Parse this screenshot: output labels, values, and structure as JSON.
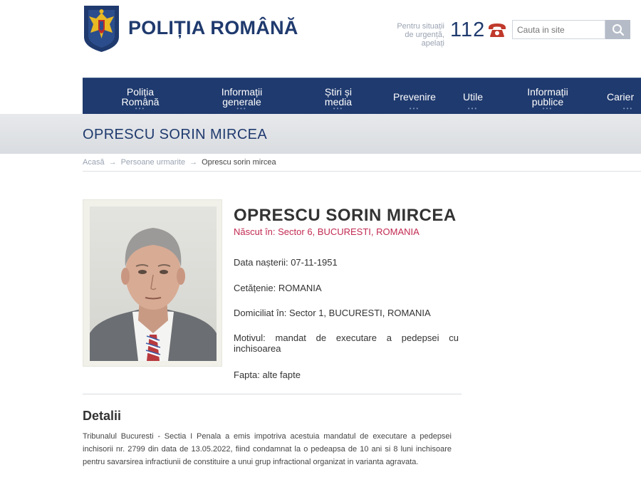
{
  "header": {
    "brand": "POLIȚIA ROMÂNĂ",
    "emergency_text": "Pentru situații de urgență, apelați",
    "emergency_number": "112",
    "search_placeholder": "Cauta in site",
    "colors": {
      "brand": "#1f3a6e",
      "accent": "#c22a52",
      "phone": "#c0392b"
    }
  },
  "nav": {
    "items": [
      {
        "label": "Poliția\nRomână"
      },
      {
        "label": "Informații\ngenerale"
      },
      {
        "label": "Știri și\nmedia"
      },
      {
        "label": "Prevenire"
      },
      {
        "label": "Utile"
      },
      {
        "label": "Informații\npublice"
      },
      {
        "label": "Carier"
      }
    ]
  },
  "page_title": "OPRESCU SORIN MIRCEA",
  "breadcrumb": {
    "home": "Acasă",
    "section": "Persoane urmarite",
    "current": "Oprescu sorin mircea",
    "separator": "→"
  },
  "profile": {
    "name": "OPRESCU SORIN MIRCEA",
    "born": "Născut în: Sector 6, BUCURESTI, ROMANIA",
    "birth_date": "Data nașterii: 07-11-1951",
    "citizenship": "Cetățenie: ROMANIA",
    "domicile": "Domiciliat în: Sector 1, BUCURESTI, ROMANIA",
    "motive": "Motivul: mandat de executare a pedepsei cu inchisoarea",
    "deed": "Fapta: alte fapte"
  },
  "details": {
    "title": "Detalii",
    "text": "Tribunalul Bucuresti - Sectia I Penala a emis impotriva acestuia mandatul de executare a pedepsei inchisorii nr. 2799 din data de 13.05.2022, fiind condamnat la o pedeapsa de 10 ani si 8 luni inchisoare pentru savarsirea infractiunii de constituire a unui grup infractional organizat in varianta agravata."
  }
}
